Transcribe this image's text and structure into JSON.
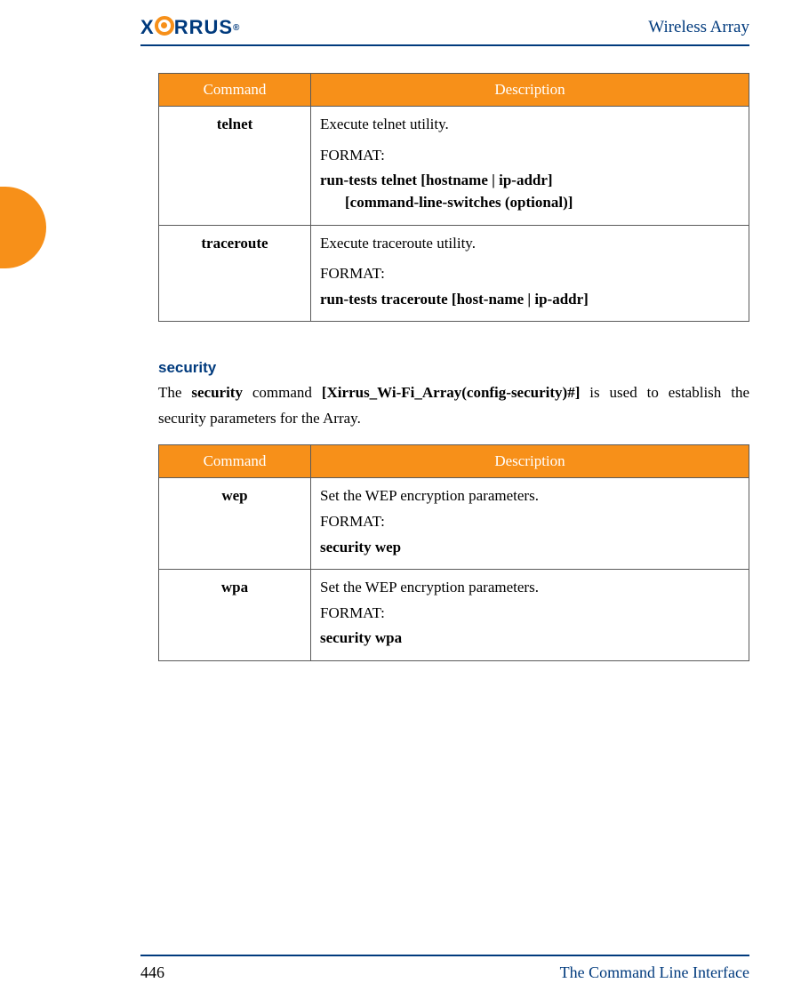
{
  "header": {
    "logo_text": "XIRRUS",
    "logo_reg": "®",
    "title": "Wireless Array"
  },
  "table1": {
    "headers": {
      "command": "Command",
      "description": "Description"
    },
    "rows": [
      {
        "command": "telnet",
        "desc_line": " Execute telnet utility.",
        "format_label": "FORMAT:",
        "syntax_line1": "run-tests telnet [hostname | ip-addr]",
        "syntax_line2": "[command-line-switches (optional)]"
      },
      {
        "command": "traceroute",
        "desc_line": " Execute traceroute utility.",
        "format_label": "FORMAT:",
        "syntax_line1": "run-tests traceroute [host-name | ip-addr]",
        "syntax_line2": ""
      }
    ]
  },
  "section": {
    "heading": "security",
    "para_pre": "The ",
    "para_b1": "security",
    "para_mid": " command ",
    "para_b2": "[Xirrus_Wi-Fi_Array(config-security)#]",
    "para_post": " is used to establish the security parameters for the Array."
  },
  "table2": {
    "headers": {
      "command": "Command",
      "description": "Description"
    },
    "rows": [
      {
        "command": "wep",
        "desc_line": "Set the WEP encryption parameters.",
        "format_label": "FORMAT:",
        "syntax_line1": "security wep"
      },
      {
        "command": "wpa",
        "desc_line": "Set the WEP encryption parameters.",
        "format_label": "FORMAT:",
        "syntax_line1": "security wpa"
      }
    ]
  },
  "footer": {
    "page": "446",
    "title": "The Command Line Interface"
  }
}
